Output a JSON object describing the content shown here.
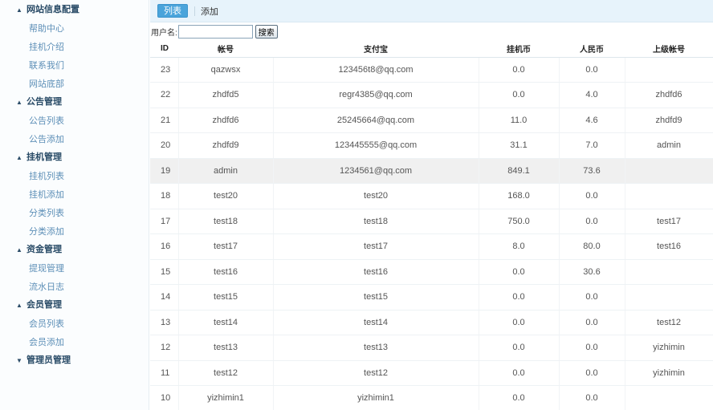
{
  "sidebar": {
    "groups": [
      {
        "label": "网站信息配置",
        "items": [
          "帮助中心",
          "挂机介绍",
          "联系我们",
          "网站底部"
        ]
      },
      {
        "label": "公告管理",
        "items": [
          "公告列表",
          "公告添加"
        ]
      },
      {
        "label": "挂机管理",
        "items": [
          "挂机列表",
          "挂机添加",
          "分类列表",
          "分类添加"
        ]
      },
      {
        "label": "资金管理",
        "items": [
          "提现管理",
          "流水日志"
        ]
      },
      {
        "label": "会员管理",
        "items": [
          "会员列表",
          "会员添加"
        ]
      },
      {
        "label": "管理员管理",
        "items": []
      }
    ]
  },
  "tabs": {
    "active": "列表",
    "other": "添加"
  },
  "search": {
    "label": "用户名:",
    "value": "",
    "placeholder": "",
    "button": "搜索"
  },
  "table": {
    "columns": [
      "ID",
      "帐号",
      "支付宝",
      "挂机币",
      "人民币",
      "上级帐号"
    ],
    "rows": [
      [
        "23",
        "qazwsx",
        "123456t8@qq.com",
        "0.0",
        "0.0",
        ""
      ],
      [
        "22",
        "zhdfd5",
        "regr4385@qq.com",
        "0.0",
        "4.0",
        "zhdfd6"
      ],
      [
        "21",
        "zhdfd6",
        "25245664@qq.com",
        "11.0",
        "4.6",
        "zhdfd9"
      ],
      [
        "20",
        "zhdfd9",
        "123445555@qq.com",
        "31.1",
        "7.0",
        "admin"
      ],
      [
        "19",
        "admin",
        "1234561@qq.com",
        "849.1",
        "73.6",
        ""
      ],
      [
        "18",
        "test20",
        "test20",
        "168.0",
        "0.0",
        ""
      ],
      [
        "17",
        "test18",
        "test18",
        "750.0",
        "0.0",
        "test17"
      ],
      [
        "16",
        "test17",
        "test17",
        "8.0",
        "80.0",
        "test16"
      ],
      [
        "15",
        "test16",
        "test16",
        "0.0",
        "30.6",
        ""
      ],
      [
        "14",
        "test15",
        "test15",
        "0.0",
        "0.0",
        ""
      ],
      [
        "13",
        "test14",
        "test14",
        "0.0",
        "0.0",
        "test12"
      ],
      [
        "12",
        "test13",
        "test13",
        "0.0",
        "0.0",
        "yizhimin"
      ],
      [
        "11",
        "test12",
        "test12",
        "0.0",
        "0.0",
        "yizhimin"
      ],
      [
        "10",
        "yizhimin1",
        "yizhimin1",
        "0.0",
        "0.0",
        ""
      ]
    ]
  }
}
